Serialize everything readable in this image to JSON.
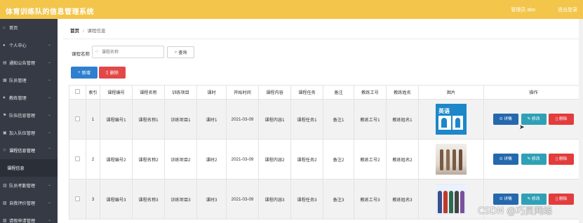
{
  "app": {
    "title": "体育训练队的信息管理系统",
    "user_label": "管理员 abo",
    "logout_label": "退出登录"
  },
  "sidebar": {
    "items": [
      {
        "label": "首页",
        "icon": "home-icon",
        "has_arrow": false
      },
      {
        "label": "个人中心",
        "icon": "user-icon",
        "has_arrow": true
      },
      {
        "label": "通知公告管理",
        "icon": "notice-icon",
        "has_arrow": true
      },
      {
        "label": "队员管理",
        "icon": "team-icon",
        "has_arrow": true
      },
      {
        "label": "教练管理",
        "icon": "coach-icon",
        "has_arrow": true
      },
      {
        "label": "队伍信息管理",
        "icon": "flag-icon",
        "has_arrow": true
      },
      {
        "label": "加入队伍管理",
        "icon": "join-icon",
        "has_arrow": true
      },
      {
        "label": "课程信息管理",
        "icon": "course-icon",
        "has_arrow": true
      },
      {
        "label": "课程信息",
        "icon": "",
        "has_arrow": false,
        "sub": true
      },
      {
        "label": "队员考勤管理",
        "icon": "attendance-icon",
        "has_arrow": true
      },
      {
        "label": "自我评价管理",
        "icon": "review-icon",
        "has_arrow": true
      },
      {
        "label": "请假申请管理",
        "icon": "leave-icon",
        "has_arrow": true
      }
    ]
  },
  "breadcrumb": {
    "home": "首页",
    "separator": "/",
    "current": "课程信息"
  },
  "search": {
    "label": "课程名称",
    "placeholder": "课程名称",
    "query_button": "查询"
  },
  "toolbar": {
    "add_label": "新增",
    "delete_label": "删除"
  },
  "table": {
    "columns": [
      "索引",
      "课程编号",
      "课程名称",
      "训练项目",
      "课时",
      "开始时间",
      "课程内容",
      "课程任务",
      "备注",
      "教练工号",
      "教练姓名",
      "图片",
      "操作"
    ],
    "rows": [
      {
        "index": "1",
        "course_no": "课程编号1",
        "course_name": "课程名称1",
        "project": "训练项目1",
        "hours": "课时1",
        "start": "2021-03-09",
        "content": "课程内容1",
        "task": "课程任务1",
        "remark": "备注1",
        "coach_no": "教练工号1",
        "coach_name": "教练姓名1"
      },
      {
        "index": "2",
        "course_no": "课程编号2",
        "course_name": "课程名称2",
        "project": "训练项目2",
        "hours": "课时2",
        "start": "2021-03-09",
        "content": "课程内容2",
        "task": "课程任务2",
        "remark": "备注2",
        "coach_no": "教练工号2",
        "coach_name": "教练姓名2"
      },
      {
        "index": "3",
        "course_no": "课程编号3",
        "course_name": "课程名称3",
        "project": "训练项目3",
        "hours": "课时3",
        "start": "2021-03-09",
        "content": "课程内容3",
        "task": "课程任务3",
        "remark": "备注3",
        "coach_no": "教练工号3",
        "coach_name": "教练姓名3"
      }
    ],
    "actions": {
      "detail": "详情",
      "edit": "修改",
      "delete": "删除"
    },
    "image1_text": "英语"
  },
  "colors": {
    "topbar": "#f3c54b",
    "sidebar": "#353a45",
    "primary": "#2f7fd0",
    "danger": "#e24848",
    "info": "#2fa1b6"
  },
  "watermark": "CSDN @巧灵网络"
}
